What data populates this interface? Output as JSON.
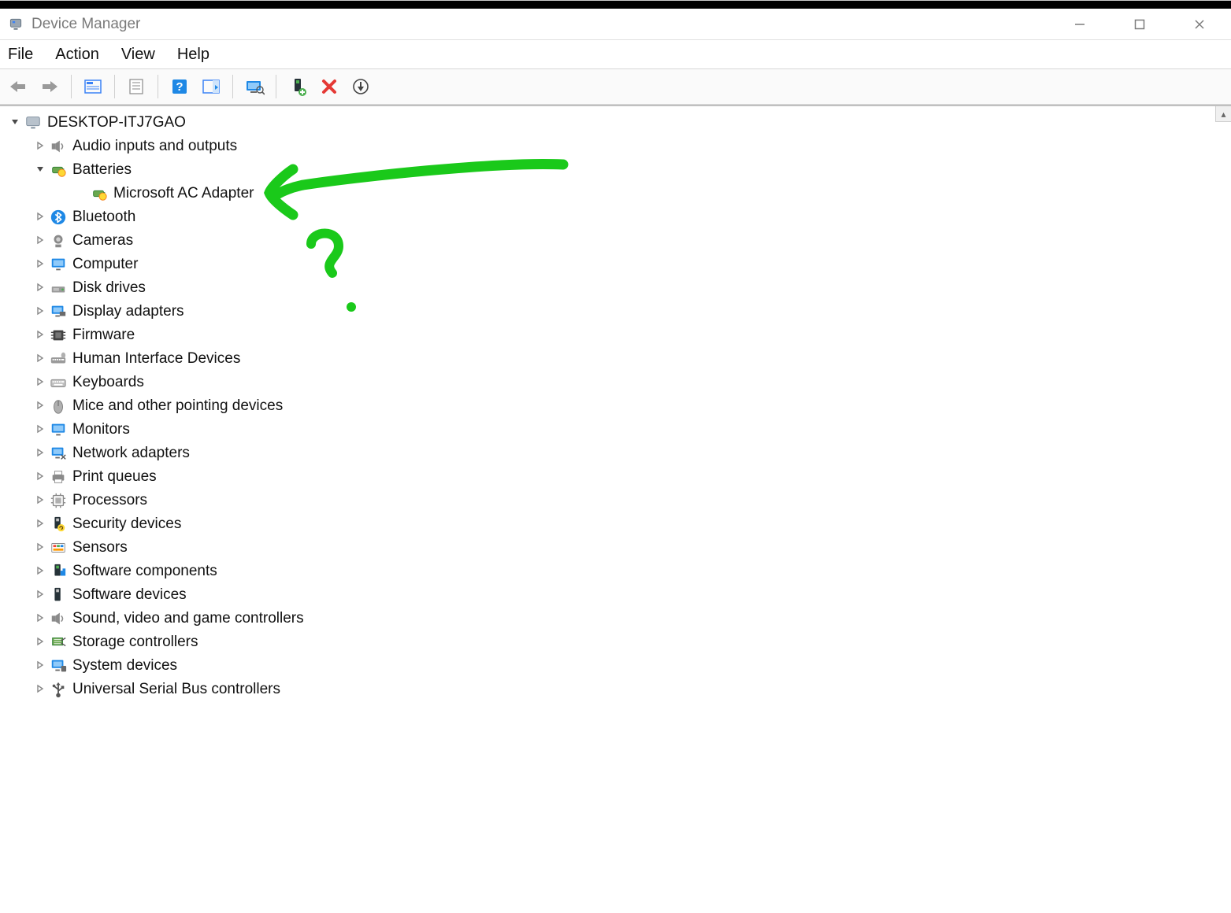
{
  "window": {
    "title": "Device Manager"
  },
  "menu": {
    "file": "File",
    "action": "Action",
    "view": "View",
    "help": "Help"
  },
  "toolbar": {
    "back": "back-icon",
    "forward": "forward-icon",
    "show_hidden": "show-hidden-icon",
    "properties": "properties-icon",
    "help": "help-icon",
    "action_pane": "action-pane-icon",
    "scan": "scan-hardware-icon",
    "add_driver": "add-driver-icon",
    "remove": "remove-device-icon",
    "update": "update-driver-icon"
  },
  "tree": {
    "root": {
      "label": "DESKTOP-ITJ7GAO",
      "expanded": true,
      "icon": "computer-icon"
    },
    "nodes": [
      {
        "label": "Audio inputs and outputs",
        "icon": "audio-icon",
        "expanded": false
      },
      {
        "label": "Batteries",
        "icon": "battery-icon",
        "expanded": true,
        "children": [
          {
            "label": "Microsoft AC Adapter",
            "icon": "battery-icon"
          }
        ]
      },
      {
        "label": "Bluetooth",
        "icon": "bluetooth-icon",
        "expanded": false
      },
      {
        "label": "Cameras",
        "icon": "camera-icon",
        "expanded": false
      },
      {
        "label": "Computer",
        "icon": "monitor-icon",
        "expanded": false
      },
      {
        "label": "Disk drives",
        "icon": "disk-icon",
        "expanded": false
      },
      {
        "label": "Display adapters",
        "icon": "display-adapter-icon",
        "expanded": false
      },
      {
        "label": "Firmware",
        "icon": "firmware-icon",
        "expanded": false
      },
      {
        "label": "Human Interface Devices",
        "icon": "hid-icon",
        "expanded": false
      },
      {
        "label": "Keyboards",
        "icon": "keyboard-icon",
        "expanded": false
      },
      {
        "label": "Mice and other pointing devices",
        "icon": "mouse-icon",
        "expanded": false
      },
      {
        "label": "Monitors",
        "icon": "monitor-icon",
        "expanded": false
      },
      {
        "label": "Network adapters",
        "icon": "network-icon",
        "expanded": false
      },
      {
        "label": "Print queues",
        "icon": "printer-icon",
        "expanded": false
      },
      {
        "label": "Processors",
        "icon": "processor-icon",
        "expanded": false
      },
      {
        "label": "Security devices",
        "icon": "security-icon",
        "expanded": false
      },
      {
        "label": "Sensors",
        "icon": "sensor-icon",
        "expanded": false
      },
      {
        "label": "Software components",
        "icon": "software-component-icon",
        "expanded": false
      },
      {
        "label": "Software devices",
        "icon": "software-device-icon",
        "expanded": false
      },
      {
        "label": "Sound, video and game controllers",
        "icon": "sound-icon",
        "expanded": false
      },
      {
        "label": "Storage controllers",
        "icon": "storage-icon",
        "expanded": false
      },
      {
        "label": "System devices",
        "icon": "system-icon",
        "expanded": false
      },
      {
        "label": "Universal Serial Bus controllers",
        "icon": "usb-icon",
        "expanded": false
      }
    ]
  },
  "annotation": {
    "arrow_color": "#1ac91a"
  }
}
